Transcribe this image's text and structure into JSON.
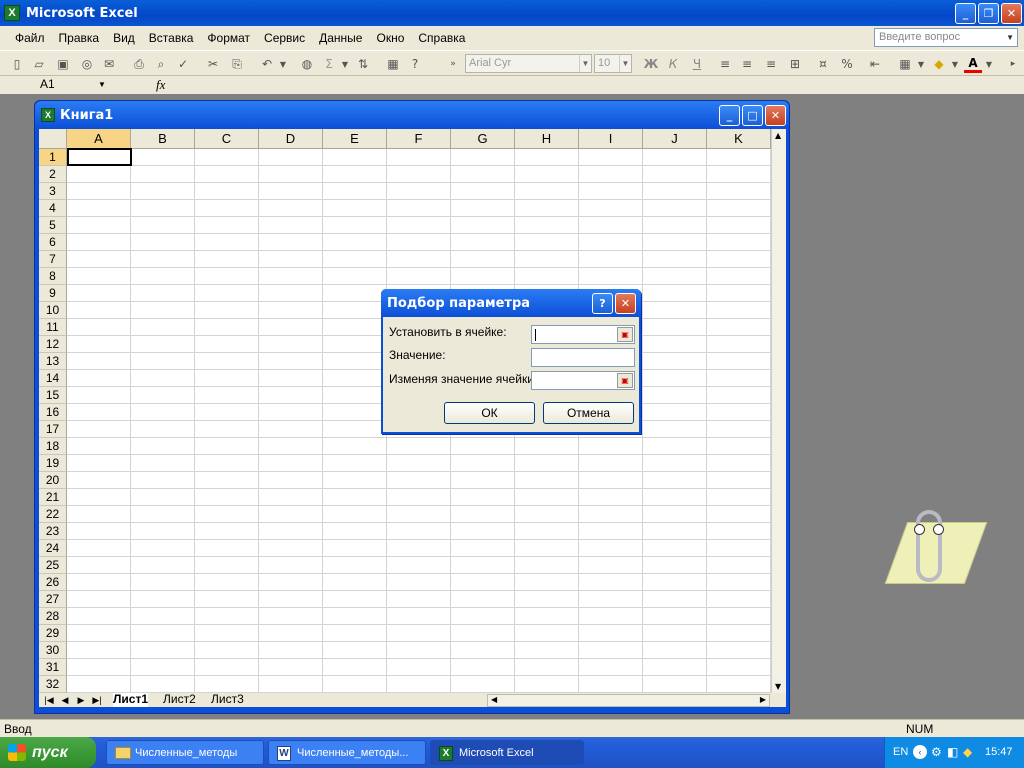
{
  "app": {
    "title": "Microsoft Excel"
  },
  "menu": [
    "Файл",
    "Правка",
    "Вид",
    "Вставка",
    "Формат",
    "Сервис",
    "Данные",
    "Окно",
    "Справка"
  ],
  "help_placeholder": "Введите вопрос",
  "toolbar": {
    "font": "Arial Cyr",
    "size": "10",
    "bold": "Ж",
    "italic": "К",
    "underline": "Ч",
    "sum": "Σ",
    "percent": "%",
    "font_color": "A"
  },
  "formula": {
    "namebox": "A1",
    "fx": "fx"
  },
  "workbook": {
    "title": "Книга1",
    "columns": [
      "A",
      "B",
      "C",
      "D",
      "E",
      "F",
      "G",
      "H",
      "I",
      "J",
      "K"
    ],
    "rows": [
      "1",
      "2",
      "3",
      "4",
      "5",
      "6",
      "7",
      "8",
      "9",
      "10",
      "11",
      "12",
      "13",
      "14",
      "15",
      "16",
      "17",
      "18",
      "19",
      "20",
      "21",
      "22",
      "23",
      "24",
      "25",
      "26",
      "27",
      "28",
      "29",
      "30",
      "31",
      "32"
    ],
    "sheets": [
      "Лист1",
      "Лист2",
      "Лист3"
    ],
    "active_cell": "A1"
  },
  "dialog": {
    "title": "Подбор параметра",
    "set_cell_label": "Установить в ячейке:",
    "value_label": "Значение:",
    "changing_cell_label": "Изменяя значение ячейки:",
    "ok": "ОК",
    "cancel": "Отмена"
  },
  "status": {
    "mode": "Ввод",
    "num": "NUM"
  },
  "taskbar": {
    "start": "пуск",
    "tasks": [
      "Численные_методы",
      "Численные_методы...",
      "Microsoft Excel"
    ],
    "lang": "EN",
    "clock": "15:47"
  }
}
